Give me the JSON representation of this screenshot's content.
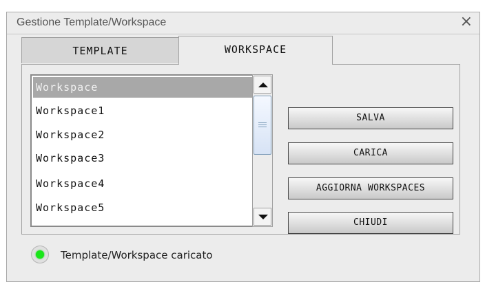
{
  "window": {
    "title": "Gestione Template/Workspace",
    "close_glyph": "×"
  },
  "tabs": [
    {
      "label": "TEMPLATE",
      "active": false
    },
    {
      "label": "WORKSPACE",
      "active": true
    }
  ],
  "workspace_list": {
    "items": [
      {
        "label": "Workspace",
        "selected": true
      },
      {
        "label": "Workspace1",
        "selected": false
      },
      {
        "label": "Workspace2",
        "selected": false
      },
      {
        "label": "Workspace3",
        "selected": false
      },
      {
        "label": "Workspace4",
        "selected": false
      },
      {
        "label": "Workspace5",
        "selected": false
      }
    ]
  },
  "buttons": {
    "salva": "SALVA",
    "carica": "CARICA",
    "aggiorna": "AGGIORNA WORKSPACES",
    "chiudi": "CHIUDI"
  },
  "status": {
    "text": "Template/Workspace caricato",
    "indicator_color": "#19e619"
  },
  "colors": {
    "selected_row": "#a8a8a8",
    "scroll_thumb_border": "#7f9db9"
  }
}
